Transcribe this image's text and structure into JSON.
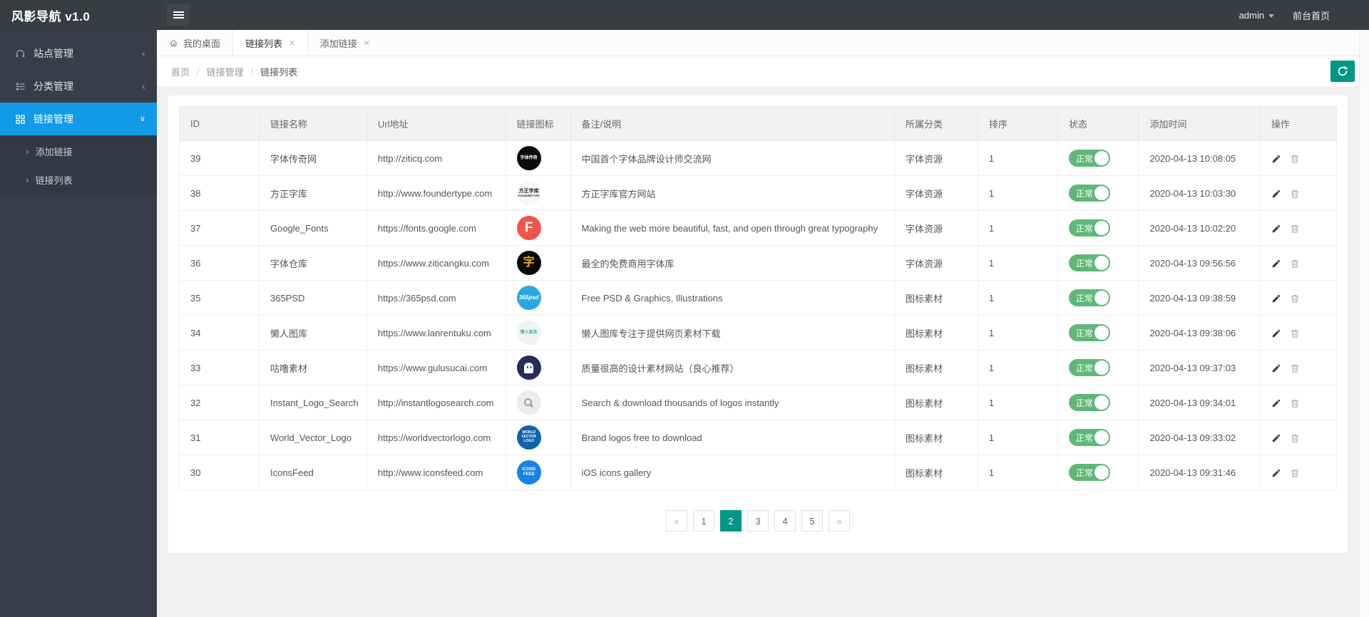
{
  "app": {
    "title": "风影导航 v1.0"
  },
  "topbar": {
    "user": "admin",
    "front_home": "前台首页"
  },
  "sidebar": {
    "items": [
      {
        "label": "站点管理",
        "icon": "site-icon",
        "expanded": false,
        "active": false,
        "children": []
      },
      {
        "label": "分类管理",
        "icon": "category-icon",
        "expanded": false,
        "active": false,
        "children": []
      },
      {
        "label": "链接管理",
        "icon": "link-icon",
        "expanded": true,
        "active": true,
        "children": [
          "添加链接",
          "链接列表"
        ]
      }
    ]
  },
  "tabs": [
    {
      "label": "我的桌面",
      "icon": "home-icon",
      "closable": false,
      "active": false
    },
    {
      "label": "链接列表",
      "closable": true,
      "active": true
    },
    {
      "label": "添加链接",
      "closable": true,
      "active": false
    }
  ],
  "breadcrumb": {
    "items": [
      "首页",
      "链接管理",
      "链接列表"
    ],
    "separator": "/"
  },
  "table": {
    "columns": [
      "ID",
      "链接名称",
      "Url地址",
      "链接图标",
      "备注/说明",
      "所属分类",
      "排序",
      "状态",
      "添加时间",
      "操作"
    ],
    "rows": [
      {
        "id": "39",
        "name": "字体传奇网",
        "url": "http://ziticq.com",
        "note": "中国首个字体品牌设计师交流网",
        "category": "字体资源",
        "order": "1",
        "status": "正常",
        "time": "2020-04-13 10:08:05",
        "icon": {
          "bg": "#0a0a0a",
          "color": "#ffffff",
          "lines": [
            "字体传奇"
          ],
          "fs": 6
        }
      },
      {
        "id": "38",
        "name": "方正字库",
        "url": "http://www.foundertype.com",
        "note": "方正字库官方网站",
        "category": "字体资源",
        "order": "1",
        "status": "正常",
        "time": "2020-04-13 10:03:30",
        "icon": {
          "bg": "#f7f7f7",
          "color": "#1a1a1a",
          "lines": [
            "方正字库",
            "FOUNDERTYPE"
          ],
          "fs": 7,
          "fs2": 4
        }
      },
      {
        "id": "37",
        "name": "Google_Fonts",
        "url": "https://fonts.google.com",
        "note": "Making the web more beautiful, fast, and open through great typography",
        "category": "字体资源",
        "order": "1",
        "status": "正常",
        "time": "2020-04-13 10:02:20",
        "icon": {
          "bg": "#f0544c",
          "color": "#ffffff",
          "lines": [
            "F"
          ],
          "fs": 19
        }
      },
      {
        "id": "36",
        "name": "字体仓库",
        "url": "https://www.ziticangku.com",
        "note": "最全的免费商用字体库",
        "category": "字体资源",
        "order": "1",
        "status": "正常",
        "time": "2020-04-13 09:56:56",
        "icon": {
          "bg": "#0a0a0a",
          "color": "#f7a823",
          "lines": [
            "字"
          ],
          "fs": 16
        }
      },
      {
        "id": "35",
        "name": "365PSD",
        "url": "https://365psd.com",
        "note": "Free PSD & Graphics, Illustrations",
        "category": "图标素材",
        "order": "1",
        "status": "正常",
        "time": "2020-04-13 09:38:59",
        "icon": {
          "bg": "#2ba7e0",
          "color": "#ffffff",
          "lines": [
            "365psd"
          ],
          "fs": 8,
          "italic": true
        }
      },
      {
        "id": "34",
        "name": "懒人图库",
        "url": "https://www.lanrentuku.com",
        "note": "懒人图库专注于提供网页素材下载",
        "category": "图标素材",
        "order": "1",
        "status": "正常",
        "time": "2020-04-13 09:38:06",
        "icon": {
          "bg": "#eef3f3",
          "color": "#53b8b0",
          "lines": [
            "懒人图库"
          ],
          "fs": 6
        }
      },
      {
        "id": "33",
        "name": "咕噜素材",
        "url": "https://www.gulusucai.com",
        "note": "质量很高的设计素材网站（良心推荐）",
        "category": "图标素材",
        "order": "1",
        "status": "正常",
        "time": "2020-04-13 09:37:03",
        "icon": {
          "bg": "#232f58",
          "color": "#ffffff",
          "kind": "ghost"
        }
      },
      {
        "id": "32",
        "name": "Instant_Logo_Search",
        "url": "http://instantlogosearch.com",
        "note": "Search & download thousands of logos instantly",
        "category": "图标素材",
        "order": "1",
        "status": "正常",
        "time": "2020-04-13 09:34:01",
        "icon": {
          "bg": "#ececec",
          "color": "#9aa2a9",
          "kind": "search"
        }
      },
      {
        "id": "31",
        "name": "World_Vector_Logo",
        "url": "https://worldvectorlogo.com",
        "note": "Brand logos free to download",
        "category": "图标素材",
        "order": "1",
        "status": "正常",
        "time": "2020-04-13 09:33:02",
        "icon": {
          "bg": "#0d62ae",
          "color": "#ffffff",
          "lines": [
            "WORLD",
            "VECTOR",
            "LOGO"
          ],
          "fs": 5
        }
      },
      {
        "id": "30",
        "name": "IconsFeed",
        "url": "http://www.iconsfeed.com",
        "note": "iOS icons gallery",
        "category": "图标素材",
        "order": "1",
        "status": "正常",
        "time": "2020-04-13 09:31:46",
        "icon": {
          "bg": "#1782e8",
          "color": "#ffffff",
          "lines": [
            "ICONS",
            "FEED"
          ],
          "fs": 6
        }
      }
    ]
  },
  "pagination": {
    "items": [
      "«",
      "1",
      "2",
      "3",
      "4",
      "5",
      "»"
    ],
    "active": "2"
  },
  "colors": {
    "topbar": "#373d41",
    "sidebar": "#393d49",
    "active_item": "#119be9",
    "accent_teal": "#009688",
    "status_green": "#5fb878",
    "page_bg": "#f1f1f1"
  }
}
